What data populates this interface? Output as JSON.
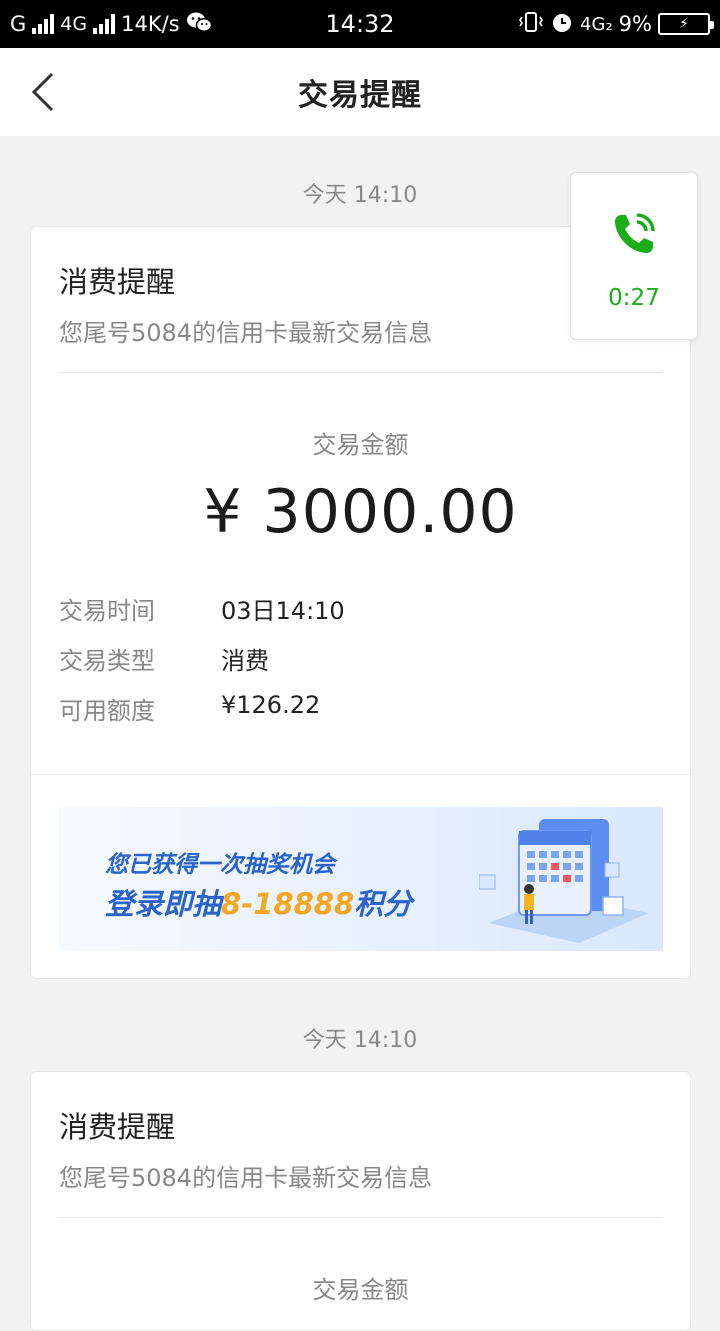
{
  "status_bar": {
    "carrier1": "G",
    "network": "4G",
    "speed": "14K/s",
    "time": "14:32",
    "network2": "4G₂",
    "battery": "9%"
  },
  "header": {
    "title": "交易提醒"
  },
  "messages": [
    {
      "timestamp": "今天 14:10",
      "title": "消费提醒",
      "subtitle": "您尾号5084的信用卡最新交易信息",
      "amount_label": "交易金额",
      "amount": "¥ 3000.00",
      "rows": [
        {
          "key": "交易时间",
          "value": "03日14:10"
        },
        {
          "key": "交易类型",
          "value": "消费"
        },
        {
          "key": "可用额度",
          "value": "¥126.22"
        }
      ],
      "banner": {
        "line1": "您已获得一次抽奖机会",
        "line2_prefix": "登录即抽",
        "line2_highlight": "8-18888",
        "line2_suffix": "积分"
      }
    },
    {
      "timestamp": "今天 14:10",
      "title": "消费提醒",
      "subtitle": "您尾号5084的信用卡最新交易信息",
      "amount_label": "交易金额"
    }
  ],
  "call_float": {
    "duration": "0:27",
    "icon": "phone-call-icon",
    "color": "#1aad19"
  }
}
